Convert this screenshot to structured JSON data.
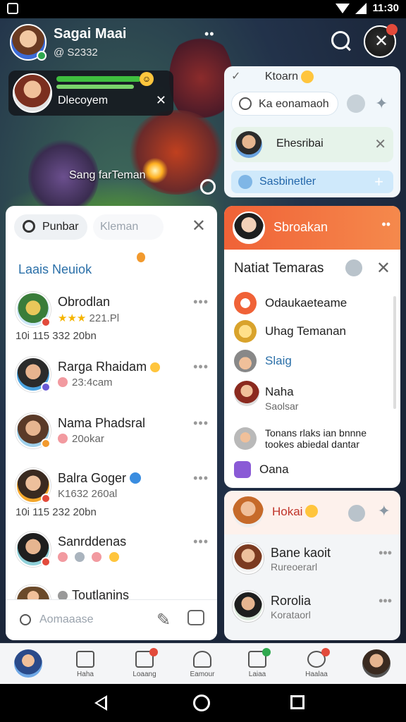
{
  "status_bar": {
    "time": "11:30"
  },
  "game": {
    "profile": {
      "name": "Sagai Maai",
      "id": "@ S2332",
      "dots": "••"
    },
    "call_card": {
      "name": "Dlecoyem"
    },
    "caption": "Sang farTeman"
  },
  "top_right": {
    "header": "Ktoarn",
    "pill_text": "Ka eonamaoh",
    "item_name": "Ehesribai",
    "button_label": "Sasbinetler"
  },
  "friends_panel": {
    "search_label": "Punbar",
    "tab_label": "Kleman",
    "section_title": "Laais Neuiok",
    "friends": [
      {
        "name": "Obrodlan",
        "sub": "221.Pl",
        "sub2": "10i  115 332 20bn"
      },
      {
        "name": "Rarga Rhaidam",
        "sub": "23:4cam",
        "sub2": ""
      },
      {
        "name": "Nama Phadsral",
        "sub": "20okar",
        "sub2": ""
      },
      {
        "name": "Balra Goger",
        "sub": "K1632 260al",
        "sub2": "10i  115 232 20bn"
      },
      {
        "name": "Sanrddenas",
        "sub": "",
        "sub2": ""
      },
      {
        "name": "Toutlanins",
        "sub": "",
        "sub2": ""
      }
    ],
    "bottom_placeholder": "Aomaaase"
  },
  "notif_panel": {
    "header_name": "Sbroakan",
    "title": "Natiat Temaras",
    "items": [
      {
        "title": "Odaukaeteame",
        "sub": ""
      },
      {
        "title": "Uhag Temanan",
        "sub": ""
      },
      {
        "title": "Slaig",
        "sub": ""
      },
      {
        "title": "Naha",
        "sub": "Saolsar"
      },
      {
        "title": "Tonans rlaks ian bnnne",
        "sub": "tookes abiedal dantar"
      },
      {
        "title": "Oana",
        "sub": ""
      }
    ]
  },
  "chat_panel": {
    "header_name": "Hokai",
    "rows": [
      {
        "name": "Bane kaoit",
        "sub": "Rureoerarl"
      },
      {
        "name": "Rorolia",
        "sub": "Korataorl"
      }
    ]
  },
  "app_nav": {
    "items": [
      {
        "label": "Haha"
      },
      {
        "label": "Loaang"
      },
      {
        "label": "Eamour"
      },
      {
        "label": "Laiaa"
      },
      {
        "label": "Haalaa"
      }
    ]
  },
  "colors": {
    "accent_orange": "#f06237",
    "accent_blue": "#2a6fa8",
    "online_green": "#2fa84f"
  }
}
